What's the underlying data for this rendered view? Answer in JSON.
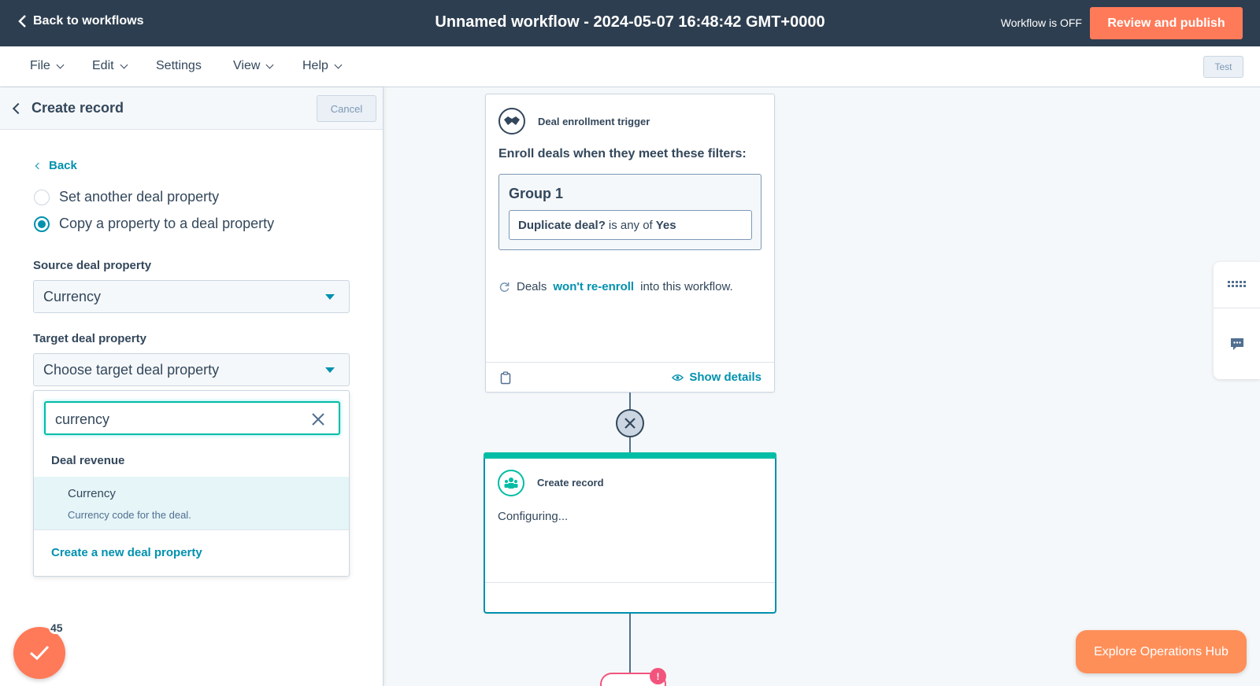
{
  "topbar": {
    "back_label": "Back to workflows",
    "title": "Unnamed workflow - 2024-05-07 16:48:42 GMT+0000",
    "status": "Workflow is OFF",
    "publish_label": "Review and publish"
  },
  "menubar": {
    "items": [
      "File",
      "Edit",
      "Settings",
      "View",
      "Help"
    ],
    "test_label": "Test"
  },
  "panel": {
    "title": "Create record",
    "cancel_label": "Cancel",
    "back_label": "Back",
    "options": [
      {
        "label": "Set another deal property",
        "checked": false
      },
      {
        "label": "Copy a property to a deal property",
        "checked": true
      }
    ],
    "source_label": "Source deal property",
    "source_value": "Currency",
    "target_label": "Target deal property",
    "target_value": "Choose target deal property",
    "dropdown": {
      "search_value": "currency",
      "group": "Deal revenue",
      "option_title": "Currency",
      "option_desc": "Currency code for the deal.",
      "create_label": "Create a new deal property"
    },
    "badge_count": "45"
  },
  "canvas": {
    "trigger": {
      "title": "Deal enrollment trigger",
      "enroll_text": "Enroll deals when they meet these filters:",
      "group_title": "Group 1",
      "filter_prop": "Duplicate deal?",
      "filter_op": "is any of",
      "filter_val": "Yes",
      "reenroll_pre": "Deals",
      "reenroll_link": "won't re-enroll",
      "reenroll_post": "into this workflow.",
      "show_details": "Show details"
    },
    "action": {
      "title": "Create record",
      "status": "Configuring..."
    },
    "warning_mark": "!"
  },
  "explore_label": "Explore Operations Hub",
  "colors": {
    "accent": "#ff7a59",
    "link": "#0091ae",
    "topbar": "#2d3e50",
    "teal": "#00bda5"
  }
}
